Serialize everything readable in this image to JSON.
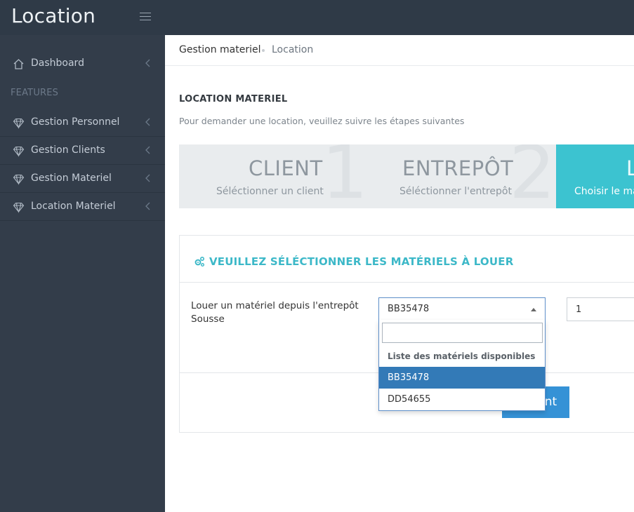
{
  "app": {
    "title": "Location"
  },
  "sidebar": {
    "section_label": "FEATURES",
    "items": [
      {
        "label": "Dashboard",
        "icon": "home-icon"
      },
      {
        "label": "Gestion Personnel",
        "icon": "diamond-icon"
      },
      {
        "label": "Gestion Clients",
        "icon": "diamond-icon"
      },
      {
        "label": "Gestion Materiel",
        "icon": "diamond-icon"
      },
      {
        "label": "Location Materiel",
        "icon": "diamond-icon"
      }
    ]
  },
  "breadcrumb": {
    "parent": "Gestion materiel",
    "current": "Location"
  },
  "page": {
    "title": "LOCATION MATERIEL",
    "subtitle": "Pour demander une location, veuillez suivre les étapes suivantes"
  },
  "steps": [
    {
      "number": "1",
      "title": "CLIENT",
      "desc": "Séléctionner un client"
    },
    {
      "number": "2",
      "title": "ENTREPÔT",
      "desc": "Séléctionner l'entrepôt"
    },
    {
      "number": "3",
      "title": "L",
      "desc": "Choisir le ma"
    }
  ],
  "panel": {
    "title": "VEUILLEZ SÉLÉCTIONNER LES MATÉRIELS À LOUER",
    "row_label": "Louer un matériel depuis l'entrepôt Sousse",
    "select_value": "BB35478",
    "quantity": "1",
    "next_button": "Suivant",
    "dropdown": {
      "search_placeholder": "",
      "group_label": "Liste des matériels disponibles",
      "options": [
        "BB35478",
        "DD54655"
      ]
    }
  },
  "colors": {
    "topbar": "#2f3a47",
    "sidebar": "#333d4a",
    "accent": "#3cc3d0",
    "primary": "#3592d6",
    "selected_option": "#337ab7"
  }
}
